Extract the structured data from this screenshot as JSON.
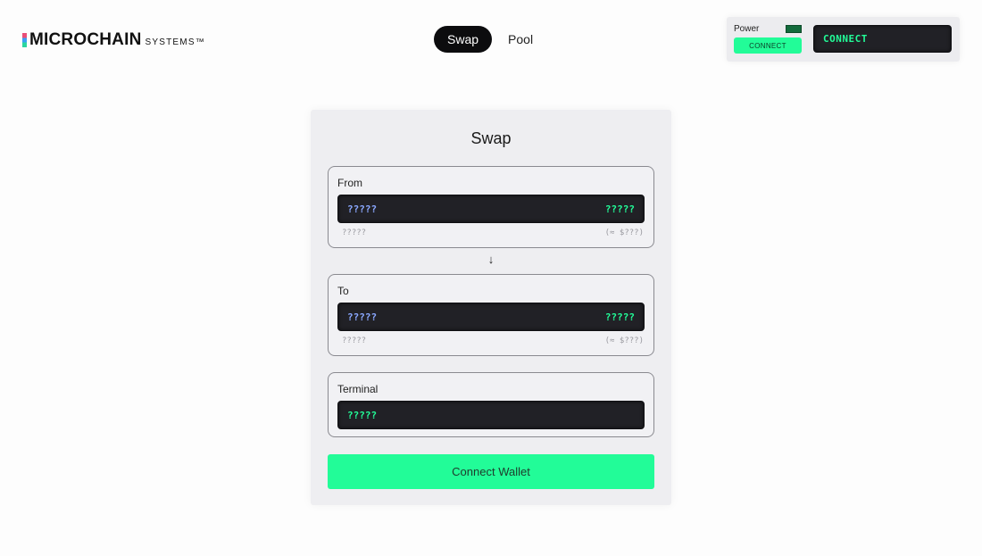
{
  "brand": {
    "name": "MICROCHAIN",
    "suffix": "SYSTEMS™"
  },
  "nav": {
    "tabs": [
      {
        "label": "Swap",
        "active": true
      },
      {
        "label": "Pool",
        "active": false
      }
    ]
  },
  "power_panel": {
    "label": "Power",
    "button_label": "CONNECT",
    "display_text": "CONNECT",
    "led_color": "#136b3c"
  },
  "swap": {
    "title": "Swap",
    "from": {
      "label": "From",
      "token": "?????",
      "amount": "?????",
      "balance": "?????",
      "usd": "(≈ $???)"
    },
    "arrow_icon": "arrow-down-icon",
    "to": {
      "label": "To",
      "token": "?????",
      "amount": "?????",
      "balance": "?????",
      "usd": "(≈ $???)"
    },
    "terminal": {
      "label": "Terminal",
      "value": "?????"
    },
    "connect_wallet_label": "Connect Wallet"
  },
  "colors": {
    "accent": "#22fc98",
    "token_text": "#8aa8ff",
    "display_bg": "#212126"
  }
}
